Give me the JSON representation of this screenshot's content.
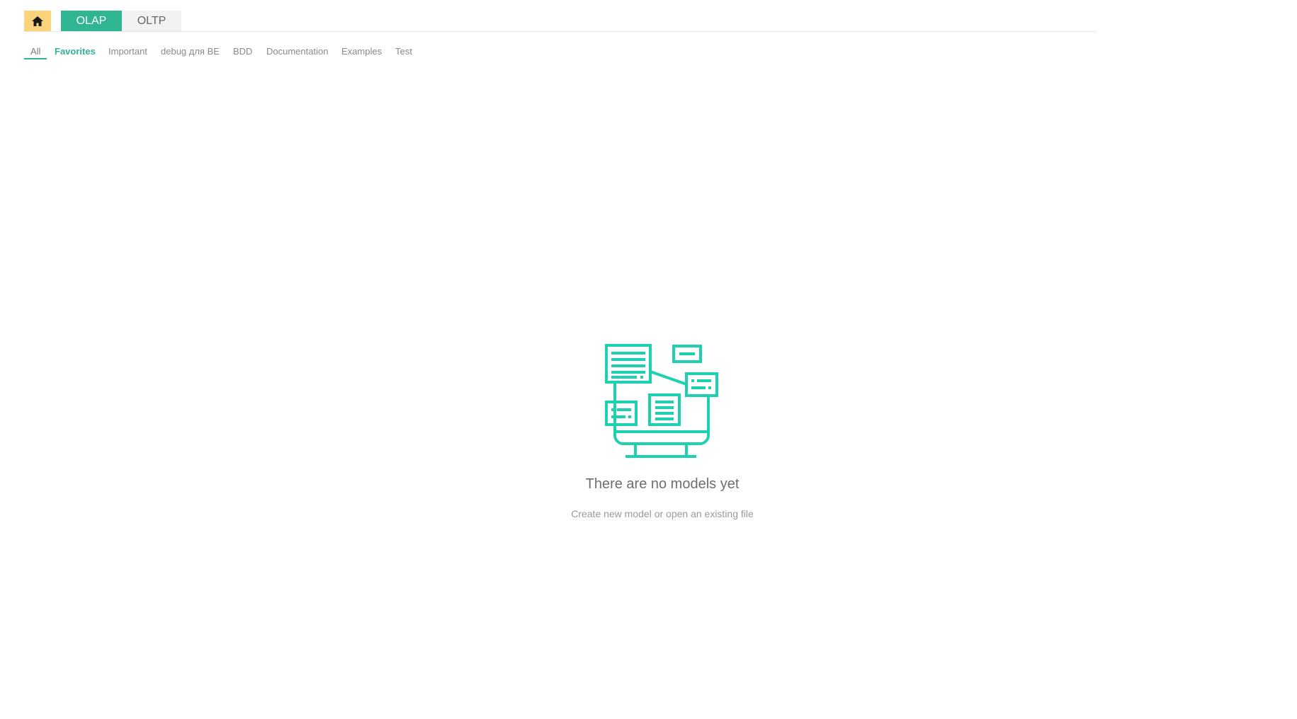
{
  "header": {
    "home_icon": "home-icon",
    "mode_tabs": [
      {
        "label": "OLAP",
        "active": true
      },
      {
        "label": "OLTP",
        "active": false
      }
    ]
  },
  "filters": [
    {
      "label": "All"
    },
    {
      "label": "Favorites"
    },
    {
      "label": "Important"
    },
    {
      "label": "debug для BE"
    },
    {
      "label": "BDD"
    },
    {
      "label": "Documentation"
    },
    {
      "label": "Examples"
    },
    {
      "label": "Test"
    }
  ],
  "empty_state": {
    "icon": "models-illustration-icon",
    "title": "There are no models yet",
    "subtitle": "Create new model or open an existing file"
  },
  "colors": {
    "accent": "#2fb592",
    "home": "#fbd37a",
    "illustration": "#1dd1b0"
  }
}
